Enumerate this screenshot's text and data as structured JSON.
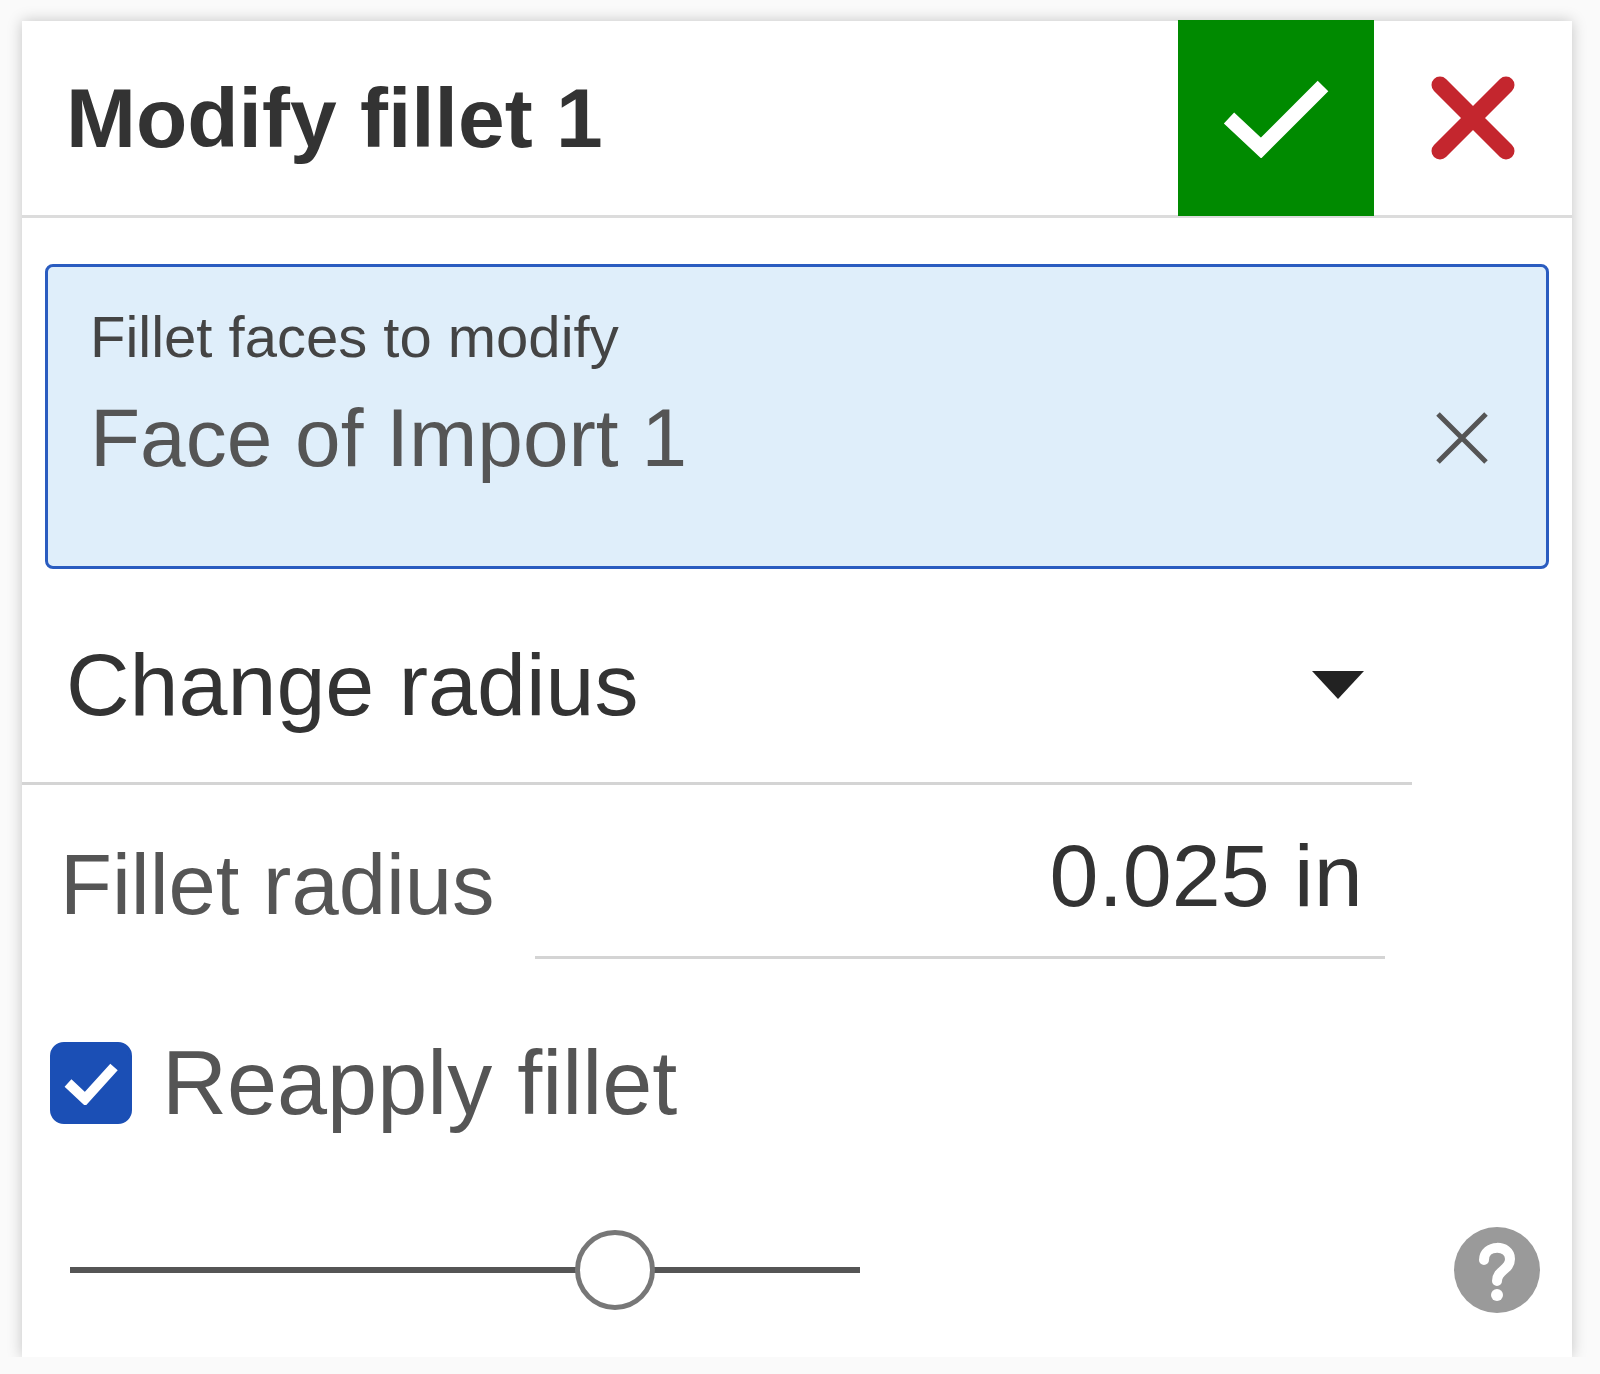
{
  "dialog": {
    "title": "Modify fillet 1"
  },
  "selection_field": {
    "label": "Fillet faces to modify",
    "value": "Face of Import 1",
    "active": true
  },
  "mode_dropdown": {
    "value": "Change radius"
  },
  "radius_field": {
    "label": "Fillet radius",
    "value": "0.025 in"
  },
  "reapply_checkbox": {
    "label": "Reapply fillet",
    "checked": true
  },
  "slider": {
    "level": 0.69
  }
}
